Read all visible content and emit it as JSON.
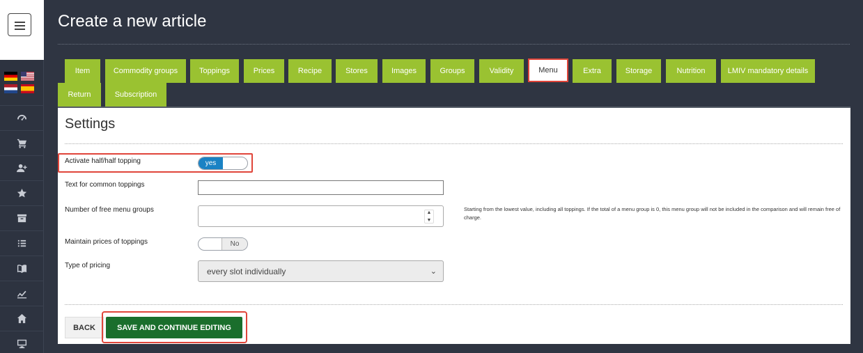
{
  "page": {
    "title": "Create a new article"
  },
  "sidebar": {
    "flags": [
      "flag-de",
      "flag-us",
      "flag-nl",
      "flag-es"
    ],
    "nav_icons": [
      "dashboard-icon",
      "cart-icon",
      "add-user-icon",
      "star-icon",
      "archive-icon",
      "list-icon",
      "book-icon",
      "chart-line-icon",
      "home-icon",
      "monitor-icon"
    ]
  },
  "tabs": [
    {
      "label": "Item"
    },
    {
      "label": "Commodity groups"
    },
    {
      "label": "Toppings"
    },
    {
      "label": "Prices"
    },
    {
      "label": "Recipe"
    },
    {
      "label": "Stores"
    },
    {
      "label": "Images"
    },
    {
      "label": "Groups"
    },
    {
      "label": "Validity"
    },
    {
      "label": "Menu",
      "active": true
    },
    {
      "label": "Extra"
    },
    {
      "label": "Storage"
    },
    {
      "label": "Nutrition"
    },
    {
      "label": "LMIV mandatory details"
    },
    {
      "label": "Return"
    },
    {
      "label": "Subscription"
    }
  ],
  "settings": {
    "title": "Settings",
    "activate_half_label": "Activate half/half topping",
    "activate_half_value": "yes",
    "common_toppings_label": "Text for common toppings",
    "common_toppings_value": "",
    "free_menu_groups_label": "Number of free menu groups",
    "free_menu_groups_value": "",
    "free_menu_groups_help": "Starting from the lowest value, including all toppings. If the total of a menu group is 0, this menu group will not be included in the comparison and will remain free of charge.",
    "maintain_prices_label": "Maintain prices of toppings",
    "maintain_prices_value": "No",
    "pricing_label": "Type of pricing",
    "pricing_value": "every slot individually"
  },
  "buttons": {
    "back": "BACK",
    "save": "SAVE AND CONTINUE EDITING"
  },
  "colors": {
    "tab": "#9ac231",
    "toggle_on": "#1a82c4",
    "save": "#1a6e2c",
    "highlight": "#e0453a"
  }
}
